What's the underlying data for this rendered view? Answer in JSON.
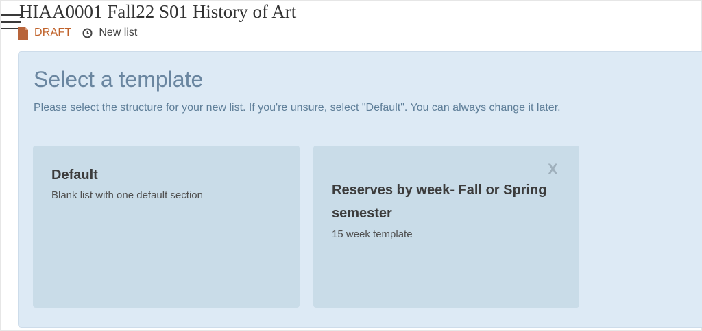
{
  "header": {
    "title": "HIAA0001 Fall22 S01 History of Art",
    "status_label": "DRAFT",
    "list_label": "New list",
    "icons": {
      "menu": "hamburger-menu-icon",
      "status": "document-icon",
      "list": "clock-icon"
    },
    "colors": {
      "draft": "#c0622a"
    }
  },
  "template_panel": {
    "heading": "Select a template",
    "instructions": "Please select the structure for your new list. If you're unsure, select \"Default\". You can always change it later.",
    "cards": [
      {
        "title": "Default",
        "description": "Blank list with one default section"
      },
      {
        "title": "Reserves by week- Fall or Spring semester",
        "description": "15 week template",
        "close_label": "X"
      }
    ],
    "colors": {
      "panel_background": "#ddeaf5",
      "card_background": "#c9dce8",
      "heading": "#6a86a0"
    }
  }
}
